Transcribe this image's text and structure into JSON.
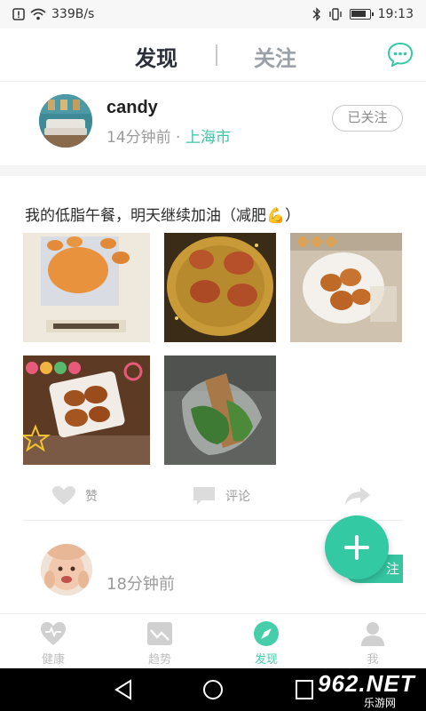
{
  "status_bar": {
    "net_speed": "339B/s",
    "time": "19:13"
  },
  "top_tabs": {
    "discover": "发现",
    "follow": "关注"
  },
  "post": {
    "username": "candy",
    "time_ago": "14分钟前",
    "separator": " · ",
    "city": "上海市",
    "follow_status": "已关注",
    "caption": "我的低脂午餐，明天继续加油（减肥💪）",
    "actions": {
      "like": "赞",
      "comment": "评论"
    }
  },
  "post2": {
    "time_ago": "18分钟前",
    "follow_partial": "注"
  },
  "bottom_nav": [
    {
      "label": "健康",
      "icon": "heart-icon"
    },
    {
      "label": "趋势",
      "icon": "trend-chart-icon"
    },
    {
      "label": "发现",
      "icon": "compass-icon"
    },
    {
      "label": "我",
      "icon": "person-icon"
    }
  ],
  "colors": {
    "accent": "#33c9a2",
    "text_dark": "#2b2f3a",
    "muted": "#9a9a9a"
  },
  "watermark": {
    "logo": "962.NET",
    "sub": "乐游网"
  }
}
